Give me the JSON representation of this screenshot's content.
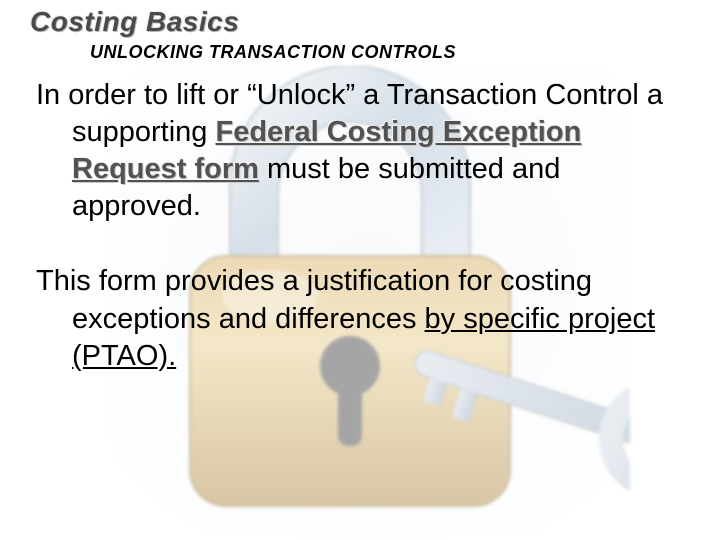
{
  "title": "Costing Basics",
  "subtitle": "UNLOCKING TRANSACTION CONTROLS",
  "p1": {
    "lead": "In order to lift or “Unlock” a Transaction Control a supporting ",
    "emph": "Federal Costing Exception Request form",
    "tail": " must be submitted and approved."
  },
  "p2": {
    "lead": "This form provides a justification for costing exceptions and differences ",
    "uline": "by specific project (PTAO)."
  }
}
